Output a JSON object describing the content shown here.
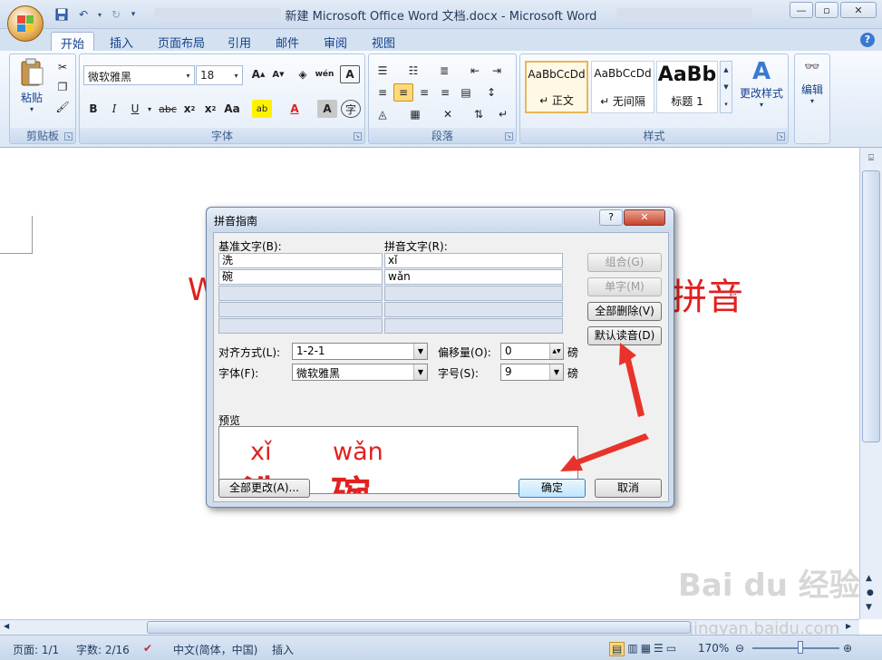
{
  "window": {
    "title": "新建 Microsoft Office Word 文档.docx - Microsoft Word"
  },
  "ribbon": {
    "tabs": [
      "开始",
      "插入",
      "页面布局",
      "引用",
      "邮件",
      "审阅",
      "视图"
    ],
    "groups": {
      "clipboard": {
        "label": "剪贴板",
        "paste_label": "粘贴"
      },
      "font": {
        "label": "字体",
        "font_name": "微软雅黑",
        "font_size": "18"
      },
      "paragraph": {
        "label": "段落"
      },
      "styles": {
        "label": "样式",
        "items": [
          {
            "preview": "AaBbCcDd",
            "name": "↵ 正文"
          },
          {
            "preview": "AaBbCcDd",
            "name": "↵ 无间隔"
          },
          {
            "preview": "AaBb",
            "name": "标题 1"
          }
        ],
        "change_styles": "更改样式"
      },
      "editing": {
        "label": "编辑"
      }
    }
  },
  "document": {
    "text_left": "W",
    "text_right": "拼音"
  },
  "dialog": {
    "title": "拼音指南",
    "help": "?",
    "close": "✕",
    "base_text_label": "基准文字(B):",
    "ruby_text_label": "拼音文字(R):",
    "rows": [
      {
        "base": "洗",
        "ruby": "xǐ"
      },
      {
        "base": "碗",
        "ruby": "wǎn"
      }
    ],
    "buttons": {
      "group": "组合(G)",
      "mono": "单字(M)",
      "clear_all": "全部删除(V)",
      "default_reading": "默认读音(D)",
      "apply_all": "全部更改(A)...",
      "ok": "确定",
      "cancel": "取消"
    },
    "alignment_label": "对齐方式(L):",
    "alignment_value": "1-2-1",
    "offset_label": "偏移量(O):",
    "offset_value": "0",
    "offset_unit": "磅",
    "font_label": "字体(F):",
    "font_value": "微软雅黑",
    "size_label": "字号(S):",
    "size_value": "9",
    "size_unit": "磅",
    "preview_label": "预览",
    "preview": {
      "ruby1": "xǐ",
      "ruby2": "wǎn",
      "base1": "洗",
      "base2": "碗"
    }
  },
  "status": {
    "page": "页面: 1/1",
    "words": "字数: 2/16",
    "language": "中文(简体，中国)",
    "mode": "插入",
    "zoom": "170%"
  },
  "watermark": {
    "brand": "Bai du 经验",
    "site": "jingyan.baidu.com"
  },
  "colors": {
    "accent_red": "#e0211f",
    "ribbon_blue": "#15428b"
  }
}
